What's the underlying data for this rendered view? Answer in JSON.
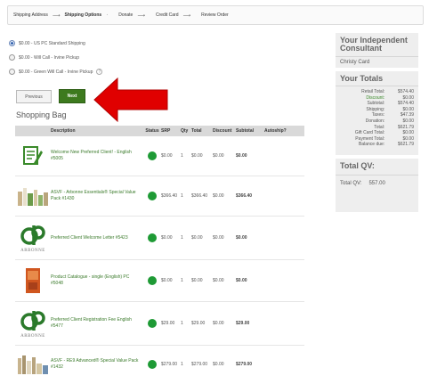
{
  "steps": [
    {
      "label": "Shipping Address",
      "bold": false
    },
    {
      "label": "Shipping Options",
      "bold": true
    },
    {
      "label": "Donate",
      "bold": false
    },
    {
      "label": "Credit Card",
      "bold": false
    },
    {
      "label": "Review Order",
      "bold": false
    }
  ],
  "shipping_options": [
    {
      "label": "$0.00 - US PC Standard Shipping",
      "selected": true
    },
    {
      "label": "$0.00 - Will Call - Irvine Pickup",
      "selected": false
    },
    {
      "label": "$0.00 - Green Will Call - Irvine Pickup",
      "selected": false
    }
  ],
  "help_glyph": "?",
  "buttons": {
    "previous": "Previous",
    "next": "Next"
  },
  "bag_title": "Shopping Bag",
  "table": {
    "headers": {
      "description": "Description",
      "status": "Status",
      "srp": "SRP",
      "qty": "Qty",
      "total": "Total",
      "discount": "Discount",
      "subtotal": "Subtotal",
      "autoship": "Autoship?"
    },
    "rows": [
      {
        "description": "Welcome New Preferred Client! - English #5005",
        "srp": "$0.00",
        "qty": "1",
        "total": "$0.00",
        "discount": "$0.00",
        "subtotal": "$0.00",
        "image": "form-icon"
      },
      {
        "description": "ASVF - Arbonne Essentials® Special Value Pack #1430",
        "srp": "$366.40",
        "qty": "1",
        "total": "$366.40",
        "discount": "$0.00",
        "subtotal": "$366.40",
        "image": "products-image"
      },
      {
        "description": "Preferred Client Welcome Letter #5423",
        "srp": "$0.00",
        "qty": "1",
        "total": "$0.00",
        "discount": "$0.00",
        "subtotal": "$0.00",
        "image": "arbonne-logo"
      },
      {
        "description": "Product Catalogue - single (English) PC #5048",
        "srp": "$0.00",
        "qty": "1",
        "total": "$0.00",
        "discount": "$0.00",
        "subtotal": "$0.00",
        "image": "catalogue-image"
      },
      {
        "description": "Preferred Client Registration Fee English #5477",
        "srp": "$29.00",
        "qty": "1",
        "total": "$29.00",
        "discount": "$0.00",
        "subtotal": "$29.00",
        "image": "arbonne-logo"
      },
      {
        "description": "ASVF - RE9 Advanced® Special Value Pack #1432",
        "srp": "$279.00",
        "qty": "1",
        "total": "$279.00",
        "discount": "$0.00",
        "subtotal": "$279.00",
        "image": "re9-products-image"
      }
    ]
  },
  "logo_text": "ARBONNE",
  "consultant": {
    "title": "Your Independent Consultant",
    "name": "Christy Card"
  },
  "totals": {
    "title": "Your Totals",
    "rows": [
      {
        "label": "Retail Total:",
        "value": "$574.40",
        "green": false
      },
      {
        "label": "Discount:",
        "value": "$0.00",
        "green": true
      },
      {
        "label": "Subtotal:",
        "value": "$574.40",
        "green": false
      },
      {
        "label": "Shipping:",
        "value": "$0.00",
        "green": false
      },
      {
        "label": "Taxes:",
        "value": "$47.39",
        "green": false
      },
      {
        "label": "Donation:",
        "value": "$0.00",
        "green": false
      },
      {
        "label": "Total:",
        "value": "$621.79",
        "green": false
      },
      {
        "label": "Gift Card Total:",
        "value": "$0.00",
        "green": false
      },
      {
        "label": "Payment Total:",
        "value": "$0.00",
        "green": false
      },
      {
        "label": "Balance due:",
        "value": "$621.79",
        "green": false
      }
    ]
  },
  "qv": {
    "title": "Total QV:",
    "label": "Total QV:",
    "value": "557.00"
  },
  "colors": {
    "accent_green": "#3d7a1e",
    "status_green": "#1e9a35",
    "annotation_arrow": "#e00000"
  }
}
